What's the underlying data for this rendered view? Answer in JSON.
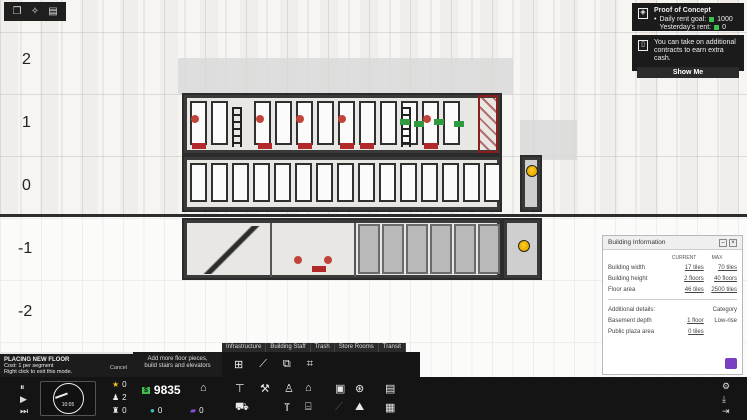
{
  "floor_labels": [
    "2",
    "1",
    "0",
    "-1",
    "-2"
  ],
  "notifications": {
    "proof": {
      "title": "Proof of Concept",
      "daily_goal_label": "Daily rent goal:",
      "daily_goal_value": "1000",
      "yesterday_label": "Yesterday's rent:",
      "yesterday_value": "0"
    },
    "contracts": {
      "text": "You can take on additional contracts to earn extra cash.",
      "button": "Show Me"
    }
  },
  "building_info": {
    "title": "Building Information",
    "col_current": "CURRENT",
    "col_max": "MAX",
    "rows": [
      {
        "label": "Building width",
        "current": "17 tiles",
        "max": "70 tiles"
      },
      {
        "label": "Building height",
        "current": "2 floors",
        "max": "40 floors"
      },
      {
        "label": "Floor area",
        "current": "46 tiles",
        "max": "2500 tiles"
      }
    ],
    "additional_label": "Additional details:",
    "category_label": "Category",
    "details": [
      {
        "label": "Basement depth",
        "current": "1 floor",
        "max": "Low-rise"
      },
      {
        "label": "Public plaza area",
        "current": "0 tiles",
        "max": ""
      }
    ]
  },
  "category_tabs": [
    "Infrastructure",
    "Building Staff",
    "Trash",
    "Store Rooms",
    "Transit"
  ],
  "placing": {
    "title": "PLACING NEW FLOOR",
    "cost": "Cost: 1 per segment",
    "hint2": "Right click to exit this mode.",
    "cancel": "Cancel"
  },
  "hint": {
    "line1": "Add more floor pieces,",
    "line2": "build stairs and elevators"
  },
  "bottom": {
    "time": "10:05",
    "stats": {
      "stars": "0",
      "people": "2",
      "workers": "0",
      "gems": "0",
      "purple": "0"
    },
    "cash": "9835",
    "cash_chip": "$"
  }
}
